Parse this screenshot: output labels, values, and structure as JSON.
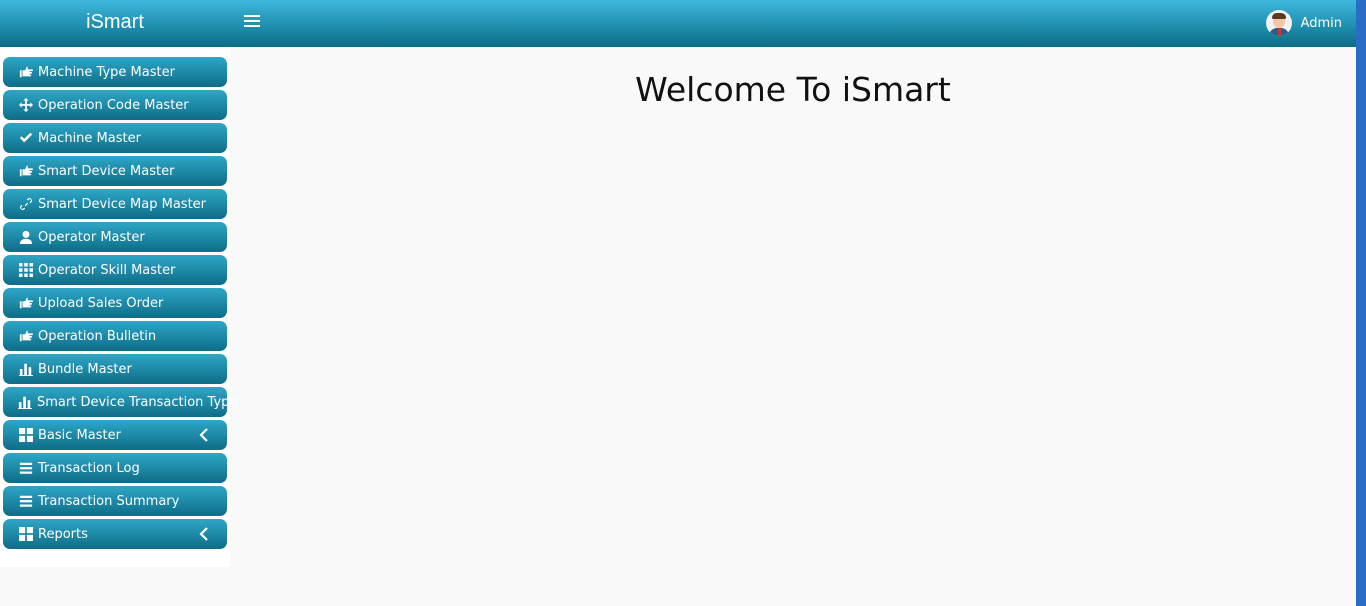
{
  "header": {
    "brand": "iSmart",
    "user_name": "Admin"
  },
  "sidebar": {
    "items": [
      {
        "label": "Machine Type Master",
        "icon": "hand-point-right-icon"
      },
      {
        "label": "Operation Code Master",
        "icon": "move-arrows-icon"
      },
      {
        "label": "Machine Master",
        "icon": "checkmark-icon"
      },
      {
        "label": "Smart Device Master",
        "icon": "hand-point-right-icon"
      },
      {
        "label": "Smart Device Map Master",
        "icon": "link-icon"
      },
      {
        "label": "Operator Master",
        "icon": "user-icon"
      },
      {
        "label": "Operator Skill Master",
        "icon": "grid-icon"
      },
      {
        "label": "Upload Sales Order",
        "icon": "hand-point-right-icon"
      },
      {
        "label": "Operation Bulletin",
        "icon": "hand-point-right-icon"
      },
      {
        "label": "Bundle Master",
        "icon": "bar-chart-icon"
      },
      {
        "label": "Smart Device Transaction Type",
        "icon": "bar-chart-icon"
      },
      {
        "label": "Basic Master",
        "icon": "windows-grid-icon",
        "expandable": true
      },
      {
        "label": "Transaction Log",
        "icon": "list-icon"
      },
      {
        "label": "Transaction Summary",
        "icon": "list-icon"
      },
      {
        "label": "Reports",
        "icon": "windows-grid-icon",
        "expandable": true
      }
    ]
  },
  "main": {
    "welcome": "Welcome To iSmart"
  },
  "colors": {
    "header_gradient_top": "#3fb8de",
    "header_gradient_bottom": "#0d6c86",
    "menu_item_top": "#2fa6c6",
    "menu_item_bottom": "#0f6c86",
    "page_background": "#f9f9f9",
    "right_edge": "#2b6cc6"
  }
}
